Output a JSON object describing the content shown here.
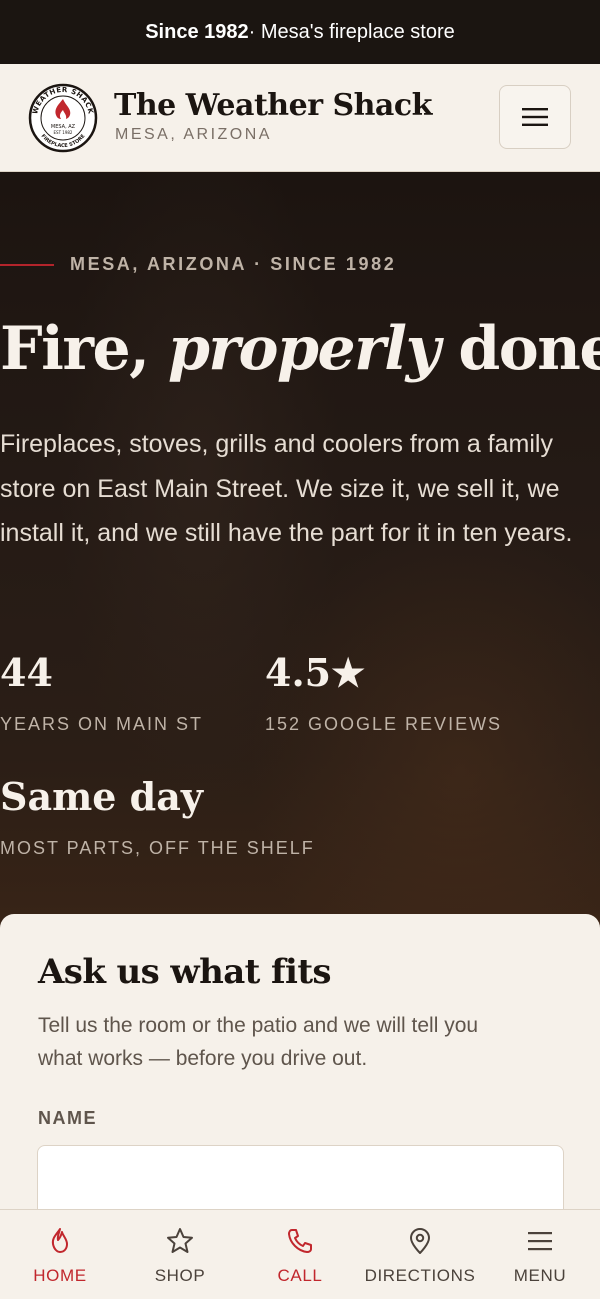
{
  "topbar": {
    "strong": "Since 1982",
    "rest": " · Mesa's fireplace store"
  },
  "header": {
    "brand_name": "The Weather Shack",
    "brand_sub": "MESA, ARIZONA",
    "logo": {
      "ring_top": "WEATHER SHACK",
      "ring_bottom": "FIREPLACE STORE",
      "center_1": "MESA, AZ",
      "center_2": "EST 1982"
    }
  },
  "hero": {
    "eyebrow": "MESA, ARIZONA · SINCE 1982",
    "headline": {
      "part1": "Fire, ",
      "italic": "properly",
      "part2": " done."
    },
    "lede": "Fireplaces, stoves, grills and coolers from a family store on East Main Street. We size it, we sell it, we install it, and we still have the part for it in ten years.",
    "stats": [
      {
        "value": "44",
        "label": "YEARS ON MAIN ST"
      },
      {
        "value": "4.5★",
        "label": "152 GOOGLE REVIEWS"
      },
      {
        "value": "Same day",
        "label": "MOST PARTS, OFF THE SHELF"
      }
    ]
  },
  "form": {
    "title": "Ask us what fits",
    "intro": "Tell us the room or the patio and we will tell you what works — before you drive out.",
    "name_label": "NAME",
    "name_value": ""
  },
  "bottom_nav": [
    {
      "label": "HOME",
      "icon": "flame-icon",
      "color": "#c1272d"
    },
    {
      "label": "SHOP",
      "icon": "star-icon",
      "color": "#4b423b"
    },
    {
      "label": "CALL",
      "icon": "phone-icon",
      "color": "#c1272d"
    },
    {
      "label": "DIRECTIONS",
      "icon": "map-pin-icon",
      "color": "#4b423b"
    },
    {
      "label": "MENU",
      "icon": "menu-icon",
      "color": "#4b423b"
    }
  ],
  "colors": {
    "accent": "#c1272d",
    "dark": "#1b1511",
    "cream": "#f6f1ea"
  }
}
